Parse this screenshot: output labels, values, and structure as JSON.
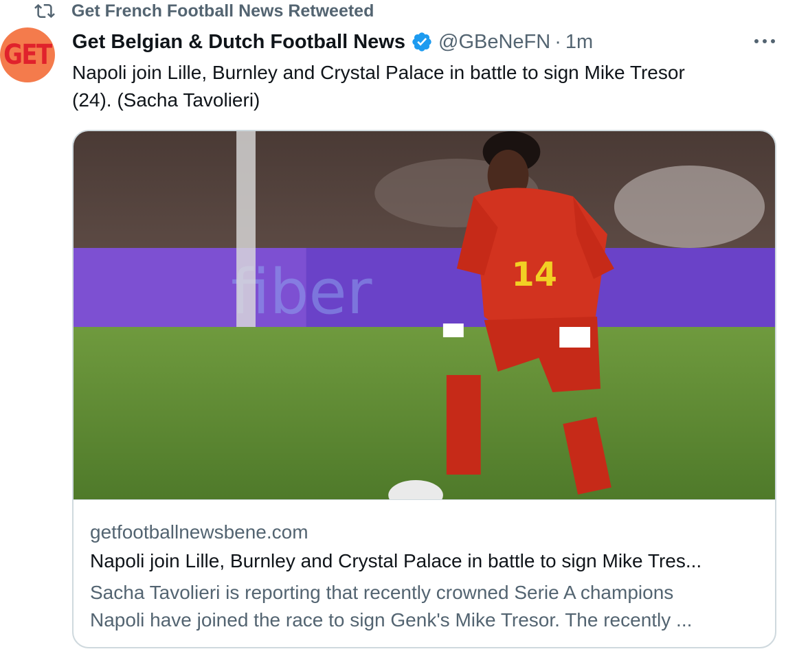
{
  "retweet": {
    "icon": "retweet-icon",
    "label": "Get French Football News Retweeted"
  },
  "author": {
    "avatar_text": "GET",
    "display_name": "Get Belgian & Dutch Football News",
    "verified_icon": "verified-badge-icon",
    "handle": "@GBeNeFN",
    "separator": "·",
    "time": "1m"
  },
  "tweet": {
    "text_line1": "Napoli join Lille, Burnley and Crystal Palace in battle to sign Mike Tresor",
    "text_line2": "(24). (Sacha Tavolieri)"
  },
  "card": {
    "image_icon": "photo-of-footballer",
    "jersey_number": "14",
    "domain": "getfootballnewsbene.com",
    "title": "Napoli join Lille, Burnley and Crystal Palace in battle to sign Mike Tres...",
    "description_line1": "Sacha Tavolieri is reporting that recently crowned Serie A champions",
    "description_line2": "Napoli have joined the race to sign Genk's Mike Tresor. The recently ..."
  },
  "colors": {
    "secondary_text": "#536471",
    "verified_blue": "#1d9bf0",
    "avatar_bg": "#f47b4c",
    "avatar_text": "#e0222c",
    "border": "#cfd9de"
  }
}
